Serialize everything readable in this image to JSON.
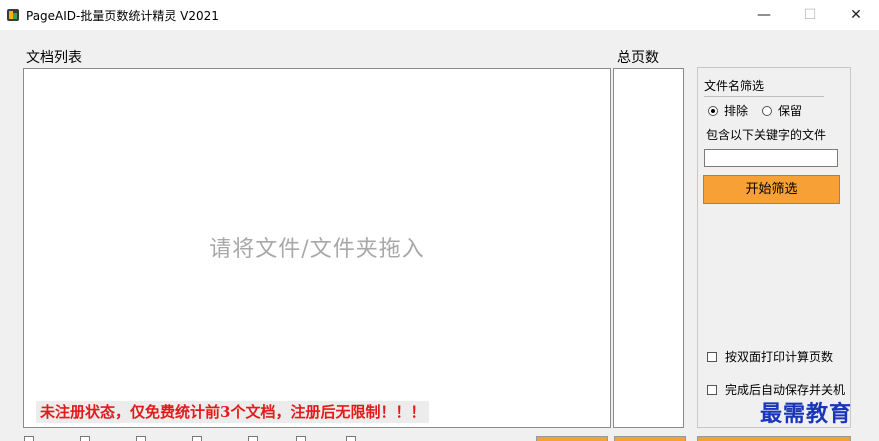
{
  "window": {
    "title": "PageAID-批量页数统计精灵 V2021",
    "minimize_glyph": "—",
    "maximize_glyph": "☐",
    "close_glyph": "✕"
  },
  "main": {
    "list_label": "文档列表",
    "pages_label": "总页数",
    "drop_hint": "请将文件/文件夹拖入",
    "unregistered_warning": "未注册状态，仅免费统计前3个文档，注册后无限制！！！",
    "warning_color": "#e11b1b"
  },
  "filter": {
    "title": "文件名筛选",
    "mode_exclude": "排除",
    "mode_keep": "保留",
    "selected_mode": "排除",
    "keyword_label": "包含以下关键字的文件",
    "keyword_value": "",
    "start_button": "开始筛选",
    "button_color": "#f6a035"
  },
  "options": {
    "duplex_label": "按双面打印计算页数",
    "duplex_checked": false,
    "autosave_label": "完成后自动保存并关机",
    "autosave_checked": false
  },
  "watermark": {
    "text": "最需教育"
  }
}
